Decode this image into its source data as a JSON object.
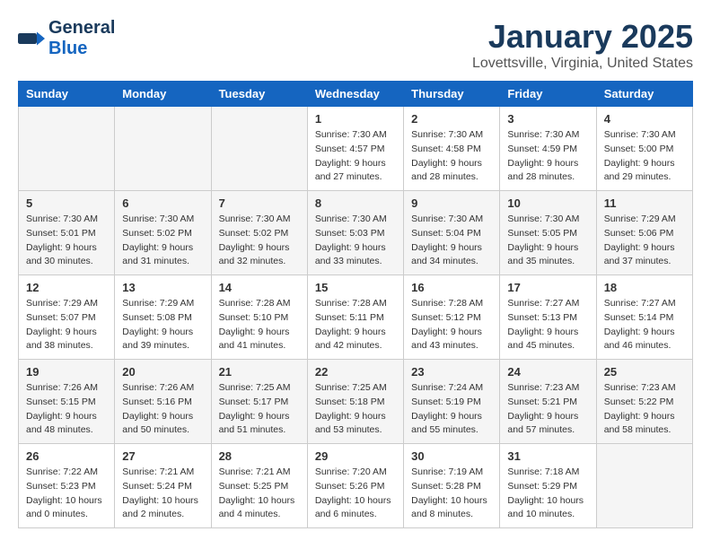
{
  "logo": {
    "line1": "General",
    "line2": "Blue"
  },
  "title": "January 2025",
  "subtitle": "Lovettsville, Virginia, United States",
  "days_of_week": [
    "Sunday",
    "Monday",
    "Tuesday",
    "Wednesday",
    "Thursday",
    "Friday",
    "Saturday"
  ],
  "weeks": [
    [
      {
        "day": "",
        "info": ""
      },
      {
        "day": "",
        "info": ""
      },
      {
        "day": "",
        "info": ""
      },
      {
        "day": "1",
        "info": "Sunrise: 7:30 AM\nSunset: 4:57 PM\nDaylight: 9 hours and 27 minutes."
      },
      {
        "day": "2",
        "info": "Sunrise: 7:30 AM\nSunset: 4:58 PM\nDaylight: 9 hours and 28 minutes."
      },
      {
        "day": "3",
        "info": "Sunrise: 7:30 AM\nSunset: 4:59 PM\nDaylight: 9 hours and 28 minutes."
      },
      {
        "day": "4",
        "info": "Sunrise: 7:30 AM\nSunset: 5:00 PM\nDaylight: 9 hours and 29 minutes."
      }
    ],
    [
      {
        "day": "5",
        "info": "Sunrise: 7:30 AM\nSunset: 5:01 PM\nDaylight: 9 hours and 30 minutes."
      },
      {
        "day": "6",
        "info": "Sunrise: 7:30 AM\nSunset: 5:02 PM\nDaylight: 9 hours and 31 minutes."
      },
      {
        "day": "7",
        "info": "Sunrise: 7:30 AM\nSunset: 5:02 PM\nDaylight: 9 hours and 32 minutes."
      },
      {
        "day": "8",
        "info": "Sunrise: 7:30 AM\nSunset: 5:03 PM\nDaylight: 9 hours and 33 minutes."
      },
      {
        "day": "9",
        "info": "Sunrise: 7:30 AM\nSunset: 5:04 PM\nDaylight: 9 hours and 34 minutes."
      },
      {
        "day": "10",
        "info": "Sunrise: 7:30 AM\nSunset: 5:05 PM\nDaylight: 9 hours and 35 minutes."
      },
      {
        "day": "11",
        "info": "Sunrise: 7:29 AM\nSunset: 5:06 PM\nDaylight: 9 hours and 37 minutes."
      }
    ],
    [
      {
        "day": "12",
        "info": "Sunrise: 7:29 AM\nSunset: 5:07 PM\nDaylight: 9 hours and 38 minutes."
      },
      {
        "day": "13",
        "info": "Sunrise: 7:29 AM\nSunset: 5:08 PM\nDaylight: 9 hours and 39 minutes."
      },
      {
        "day": "14",
        "info": "Sunrise: 7:28 AM\nSunset: 5:10 PM\nDaylight: 9 hours and 41 minutes."
      },
      {
        "day": "15",
        "info": "Sunrise: 7:28 AM\nSunset: 5:11 PM\nDaylight: 9 hours and 42 minutes."
      },
      {
        "day": "16",
        "info": "Sunrise: 7:28 AM\nSunset: 5:12 PM\nDaylight: 9 hours and 43 minutes."
      },
      {
        "day": "17",
        "info": "Sunrise: 7:27 AM\nSunset: 5:13 PM\nDaylight: 9 hours and 45 minutes."
      },
      {
        "day": "18",
        "info": "Sunrise: 7:27 AM\nSunset: 5:14 PM\nDaylight: 9 hours and 46 minutes."
      }
    ],
    [
      {
        "day": "19",
        "info": "Sunrise: 7:26 AM\nSunset: 5:15 PM\nDaylight: 9 hours and 48 minutes."
      },
      {
        "day": "20",
        "info": "Sunrise: 7:26 AM\nSunset: 5:16 PM\nDaylight: 9 hours and 50 minutes."
      },
      {
        "day": "21",
        "info": "Sunrise: 7:25 AM\nSunset: 5:17 PM\nDaylight: 9 hours and 51 minutes."
      },
      {
        "day": "22",
        "info": "Sunrise: 7:25 AM\nSunset: 5:18 PM\nDaylight: 9 hours and 53 minutes."
      },
      {
        "day": "23",
        "info": "Sunrise: 7:24 AM\nSunset: 5:19 PM\nDaylight: 9 hours and 55 minutes."
      },
      {
        "day": "24",
        "info": "Sunrise: 7:23 AM\nSunset: 5:21 PM\nDaylight: 9 hours and 57 minutes."
      },
      {
        "day": "25",
        "info": "Sunrise: 7:23 AM\nSunset: 5:22 PM\nDaylight: 9 hours and 58 minutes."
      }
    ],
    [
      {
        "day": "26",
        "info": "Sunrise: 7:22 AM\nSunset: 5:23 PM\nDaylight: 10 hours and 0 minutes."
      },
      {
        "day": "27",
        "info": "Sunrise: 7:21 AM\nSunset: 5:24 PM\nDaylight: 10 hours and 2 minutes."
      },
      {
        "day": "28",
        "info": "Sunrise: 7:21 AM\nSunset: 5:25 PM\nDaylight: 10 hours and 4 minutes."
      },
      {
        "day": "29",
        "info": "Sunrise: 7:20 AM\nSunset: 5:26 PM\nDaylight: 10 hours and 6 minutes."
      },
      {
        "day": "30",
        "info": "Sunrise: 7:19 AM\nSunset: 5:28 PM\nDaylight: 10 hours and 8 minutes."
      },
      {
        "day": "31",
        "info": "Sunrise: 7:18 AM\nSunset: 5:29 PM\nDaylight: 10 hours and 10 minutes."
      },
      {
        "day": "",
        "info": ""
      }
    ]
  ]
}
